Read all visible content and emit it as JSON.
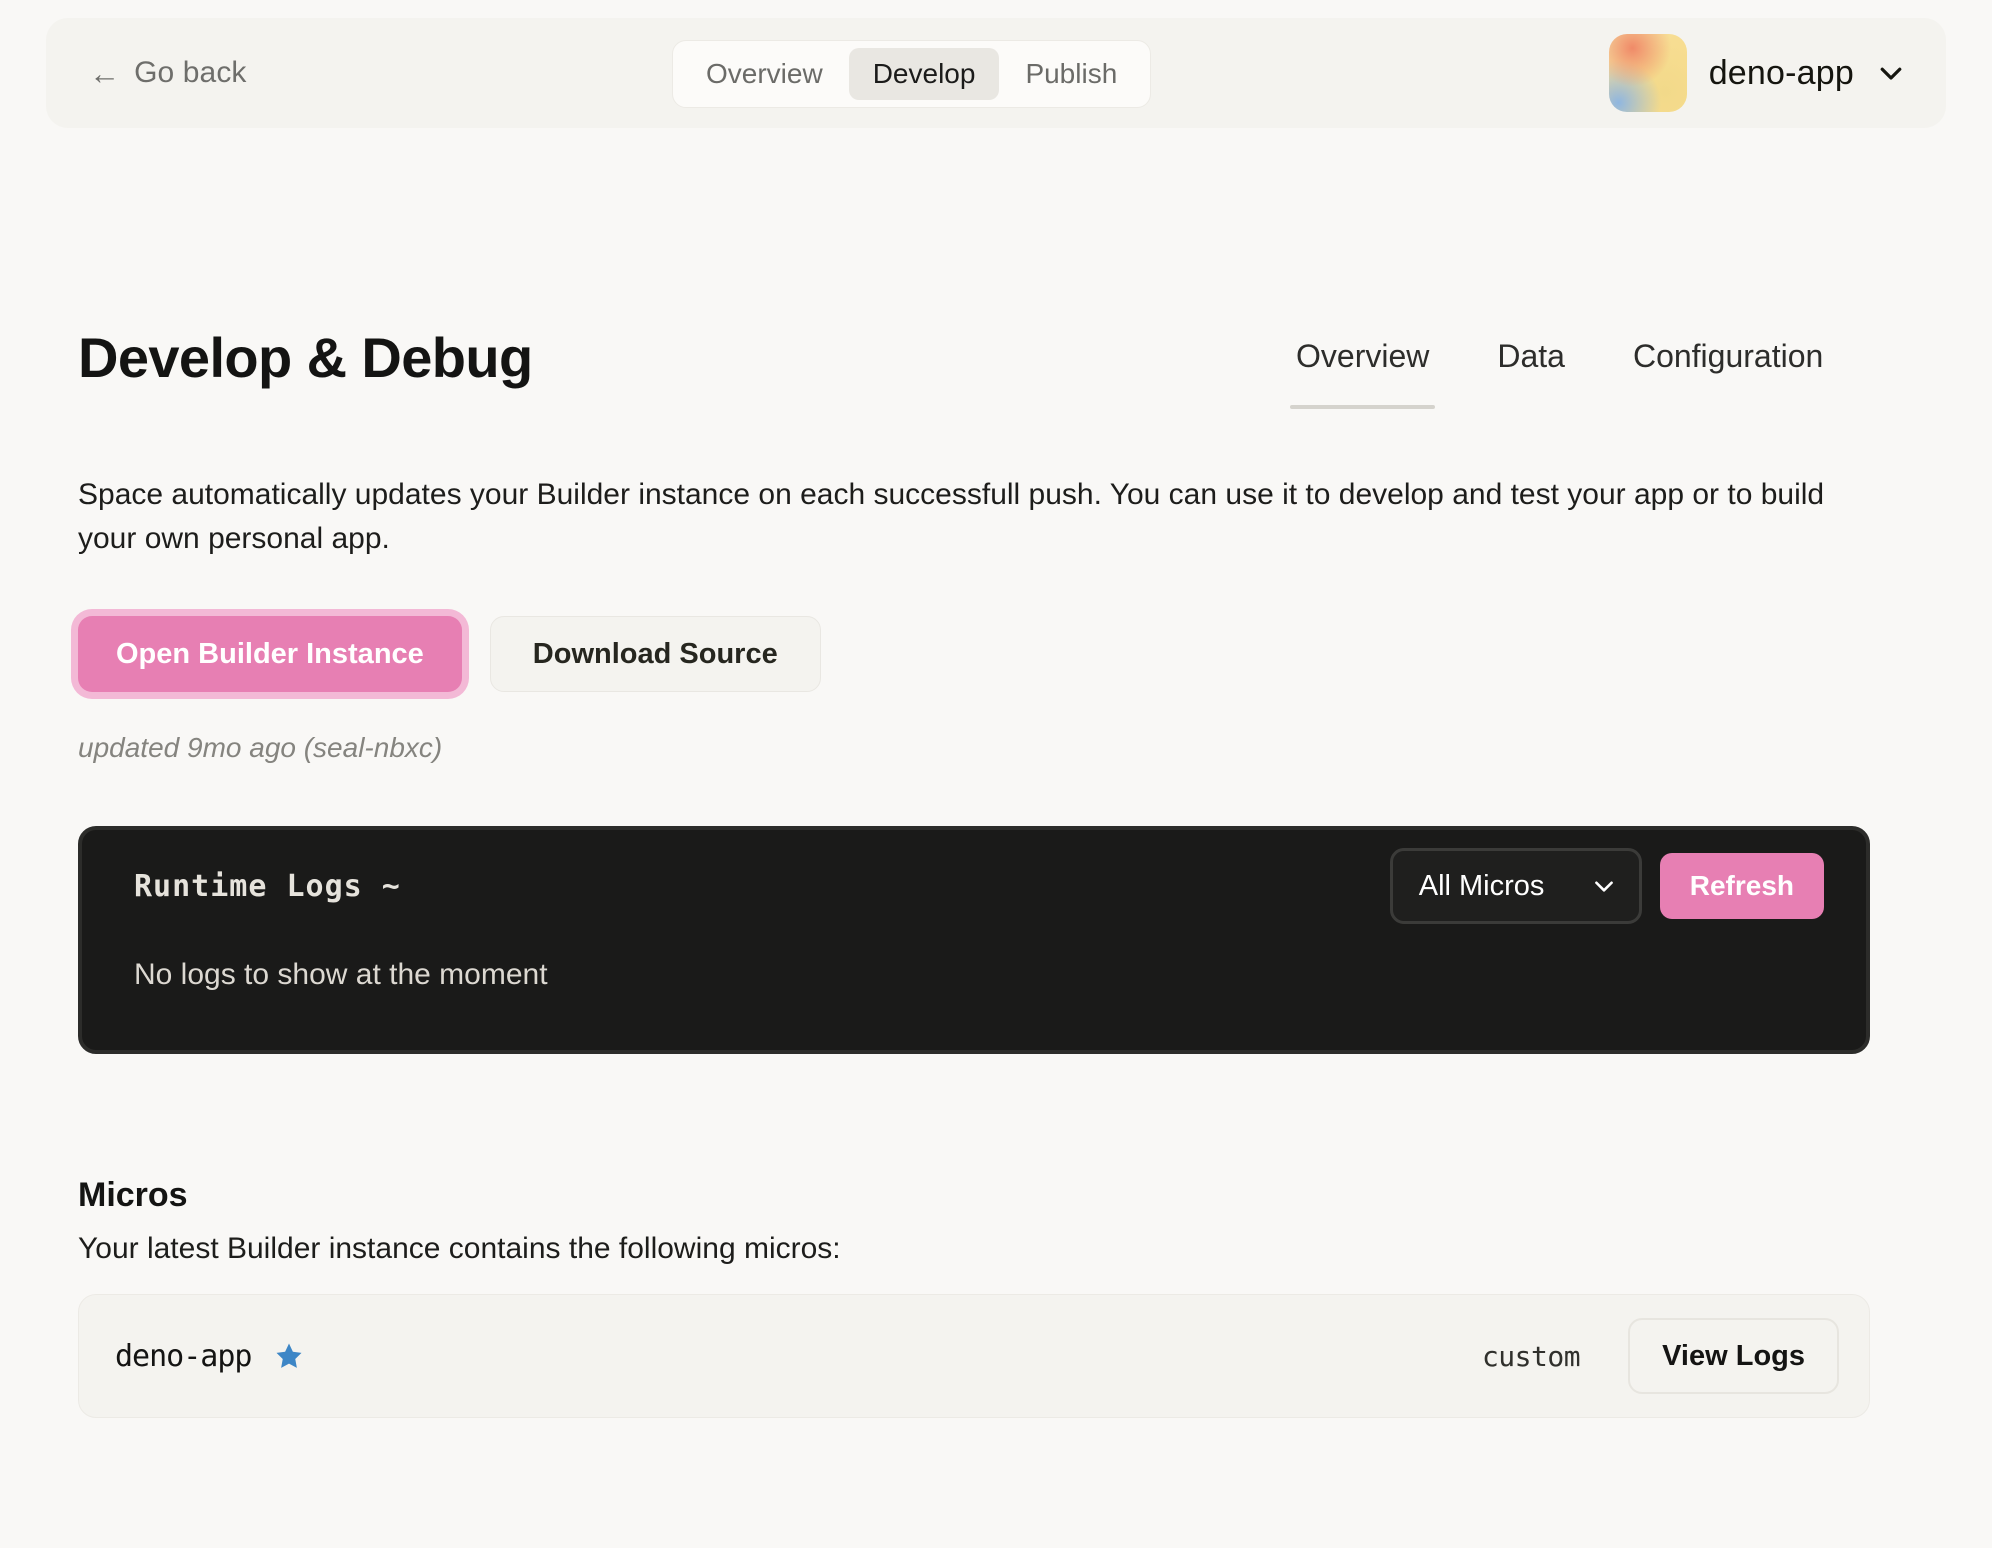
{
  "header": {
    "go_back": "Go back",
    "back_arrow_icon": "arrow-left-icon",
    "tabs": [
      {
        "label": "Overview",
        "active": false
      },
      {
        "label": "Develop",
        "active": true
      },
      {
        "label": "Publish",
        "active": false
      }
    ],
    "app": {
      "name": "deno-app",
      "avatar_icon": "gradient-avatar",
      "chevron_icon": "chevron-down-icon"
    }
  },
  "main": {
    "title": "Develop & Debug",
    "subtabs": [
      {
        "label": "Overview",
        "active": true
      },
      {
        "label": "Data",
        "active": false
      },
      {
        "label": "Configuration",
        "active": false
      }
    ],
    "description": "Space automatically updates your Builder instance on each successfull push. You can use it to develop and test your app or to build your own personal app.",
    "primary_button": "Open Builder Instance",
    "secondary_button": "Download Source",
    "updated_text": "updated 9mo ago (seal-nbxc)"
  },
  "logs": {
    "title": "Runtime Logs ~",
    "filter_value": "All Micros",
    "filter_chevron_icon": "chevron-down-icon",
    "refresh_button": "Refresh",
    "empty_message": "No logs to show at the moment"
  },
  "micros": {
    "heading": "Micros",
    "subheading": "Your latest Builder instance contains the following micros:",
    "rows": [
      {
        "name": "deno-app",
        "primary_icon": "star-icon",
        "type": "custom",
        "action_label": "View Logs"
      }
    ]
  },
  "colors": {
    "page_bg": "#f9f8f6",
    "panel_bg": "#f4f3ef",
    "accent_pink": "#e77fb3",
    "accent_pink_ring": "#f3b9d6",
    "dark_panel": "#1a1a19",
    "star_blue": "#3d86c6"
  }
}
